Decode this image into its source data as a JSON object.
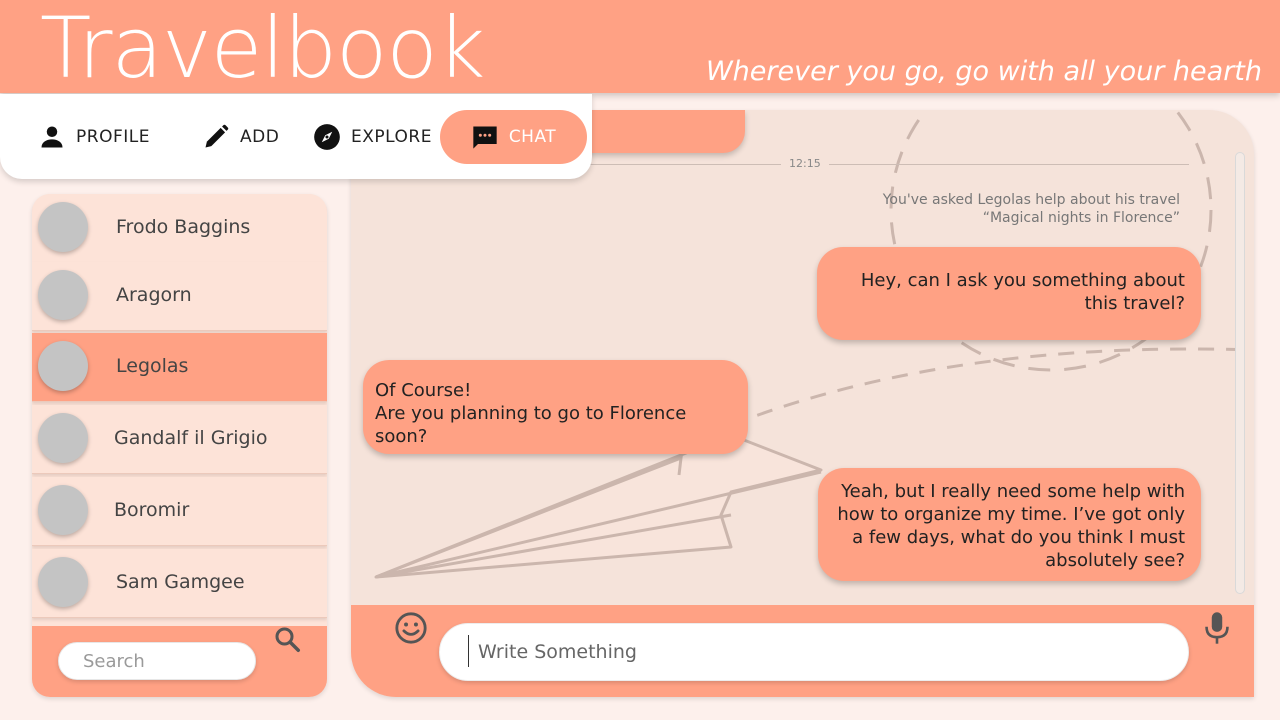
{
  "app": {
    "title": "Travelbook",
    "tagline": "Wherever you go, go with all your hearth",
    "accent_color": "#ffa184"
  },
  "nav": {
    "items": [
      {
        "label": "PROFILE",
        "icon": "person-icon"
      },
      {
        "label": "ADD",
        "icon": "pencil-icon"
      },
      {
        "label": "EXPLORE",
        "icon": "compass-icon"
      },
      {
        "label": "CHAT",
        "icon": "chat-icon",
        "active": true
      }
    ]
  },
  "contacts": {
    "items": [
      {
        "name": "Frodo Baggins"
      },
      {
        "name": "Aragorn"
      },
      {
        "name": "Legolas",
        "active": true
      },
      {
        "name": "Gandalf il Grigio"
      },
      {
        "name": "Boromir"
      },
      {
        "name": "Sam Gamgee"
      }
    ],
    "search_placeholder": "Search"
  },
  "chat": {
    "time": "12:15",
    "system_note": "You've asked Legolas help about his travel “Magical nights in Florence”",
    "messages": [
      {
        "from": "me",
        "text": "Hey, can I ask you something about this travel?"
      },
      {
        "from": "them",
        "text": "Of Course!\nAre you planning to go to Florence soon?"
      },
      {
        "from": "me",
        "text": "Yeah, but I really need some help with how to organize my time. I’ve got only a few days, what do you think I must absolutely see?"
      }
    ],
    "input_placeholder": "Write Something"
  }
}
